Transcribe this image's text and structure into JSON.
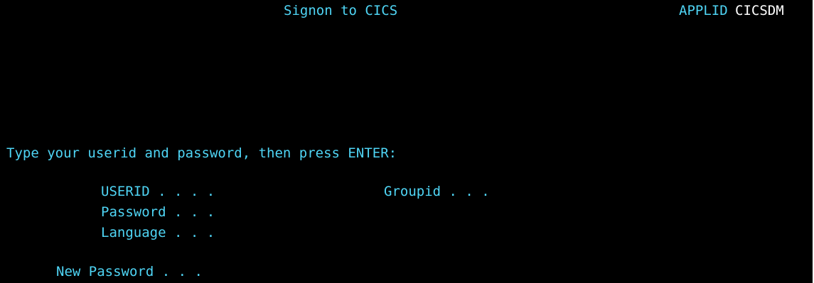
{
  "header": {
    "title": "Signon to CICS",
    "applid_label": "APPLID",
    "applid_value": "CICSDM"
  },
  "instructions": "Type your userid and password, then press ENTER:",
  "fields": {
    "userid_label": "USERID . . . .",
    "groupid_label": "Groupid . . .",
    "password_label": "Password . . .",
    "language_label": "Language . . .",
    "new_password_label": "New Password . . ."
  },
  "colors": {
    "background": "#000000",
    "text": "#4fd5f5",
    "highlight": "#ffffff"
  }
}
